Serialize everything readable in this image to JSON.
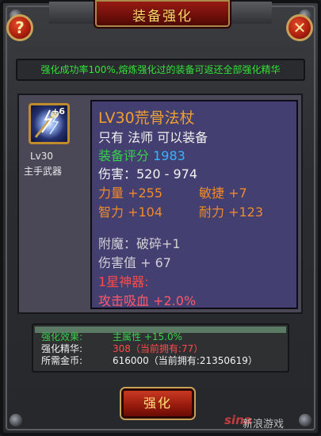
{
  "window": {
    "title": "装备强化",
    "help_label": "?",
    "close_label": "✕"
  },
  "notice": "强化成功率100%,熔炼强化过的装备可返还全部强化精华",
  "item": {
    "icon": "lightning-staff-icon",
    "enhance_level": "+6",
    "level_label": "Lv30",
    "slot_label": "主手武器",
    "name": "LV30荒骨法杖",
    "requirement": "只有 法师 可以装备",
    "score_label": "装备评分",
    "score_value": "1983",
    "damage": "伤害：520 - 974",
    "attributes": {
      "strength": "力量 +255",
      "agility": "敏捷 +7",
      "intellect": "智力 +104",
      "stamina": "耐力 +123"
    },
    "enchant": "附魔：破碎+1",
    "damage_value": "伤害值 + 67",
    "artifact_label": "1星神器:",
    "artifact_effect": "攻击吸血 +2.0%"
  },
  "stats": {
    "effect_label": "强化效果:",
    "effect_value": "主属性 +15.0%",
    "essence_label": "强化精华:",
    "essence_value": "308（当前拥有:77）",
    "gold_label": "所需金币:",
    "gold_value": "616000（当前拥有:21350619）"
  },
  "buttons": {
    "enhance": "强化"
  },
  "watermark": {
    "logo": "sina",
    "text": "新浪游戏"
  },
  "colors": {
    "title_gold": "#ffd96a",
    "notice_green": "#33e33a",
    "item_name_orange": "#f0a030",
    "score_blue": "#36b4ff",
    "artifact_red": "#ff4a4a"
  }
}
